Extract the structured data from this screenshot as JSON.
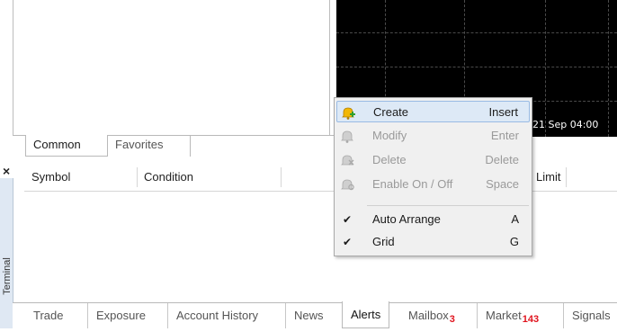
{
  "navigator": {
    "tabs": [
      {
        "label": "Common",
        "active": true
      },
      {
        "label": "Favorites",
        "active": false
      }
    ]
  },
  "chart": {
    "time_label": "21 Sep 04:00"
  },
  "terminal": {
    "side_label": "Terminal",
    "close_glyph": "×",
    "columns": [
      "Symbol",
      "Condition",
      "Limit"
    ],
    "tabs": [
      {
        "label": "Trade"
      },
      {
        "label": "Exposure"
      },
      {
        "label": "Account History"
      },
      {
        "label": "News"
      },
      {
        "label": "Alerts",
        "active": true
      },
      {
        "label": "Mailbox",
        "badge": "3"
      },
      {
        "label": "Market",
        "badge": "143"
      },
      {
        "label": "Signals"
      }
    ]
  },
  "context_menu": {
    "items": [
      {
        "label": "Create",
        "shortcut": "Insert",
        "enabled": true,
        "highlighted": true,
        "icon": "bell-add-icon"
      },
      {
        "label": "Modify",
        "shortcut": "Enter",
        "enabled": false,
        "icon": "bell-edit-icon"
      },
      {
        "label": "Delete",
        "shortcut": "Delete",
        "enabled": false,
        "icon": "bell-delete-icon"
      },
      {
        "label": "Enable On / Off",
        "shortcut": "Space",
        "enabled": false,
        "icon": "bell-toggle-icon"
      },
      {
        "label": "Auto Arrange",
        "shortcut": "A",
        "enabled": true,
        "checked": true,
        "icon": "checkmark-icon"
      },
      {
        "label": "Grid",
        "shortcut": "G",
        "enabled": true,
        "checked": true,
        "icon": "checkmark-icon"
      }
    ]
  },
  "colors": {
    "chart_bg": "#000000",
    "menu_highlight": "#dde9f6",
    "badge_red": "#e0141e",
    "bell_active": "#f2b705",
    "bell_add_plus": "#2e9e2e"
  }
}
